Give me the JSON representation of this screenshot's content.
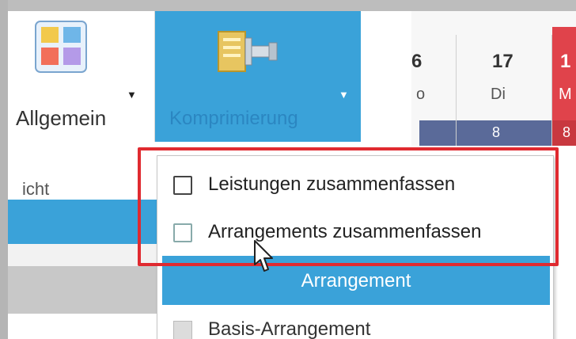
{
  "ribbon": {
    "allgemein_label": "Allgemein",
    "kompprimierung_label": "Komprimierung",
    "group_label_partial": "icht"
  },
  "calendar": {
    "days": [
      {
        "num": "6",
        "name": "o",
        "count": ""
      },
      {
        "num": "17",
        "name": "Di",
        "count": "8"
      },
      {
        "num": "1",
        "name": "M",
        "count": "8"
      }
    ]
  },
  "dropdown": {
    "items": [
      {
        "label": "Leistungen zusammenfassen",
        "checked": false
      },
      {
        "label": "Arrangements zusammenfassen",
        "checked": false
      }
    ],
    "section_header": "Arrangement",
    "basis_item": "Basis-Arrangement"
  },
  "colors": {
    "accent_blue": "#3aa2d9",
    "highlight_red": "#e02a30",
    "weekend_red": "#e0434b",
    "navy": "#5a6a99"
  },
  "icons": [
    "allgemein-grid-icon",
    "kompprimierung-clamp-icon",
    "checkbox-icon",
    "mouse-cursor-icon",
    "dropdown-arrow-icon"
  ]
}
